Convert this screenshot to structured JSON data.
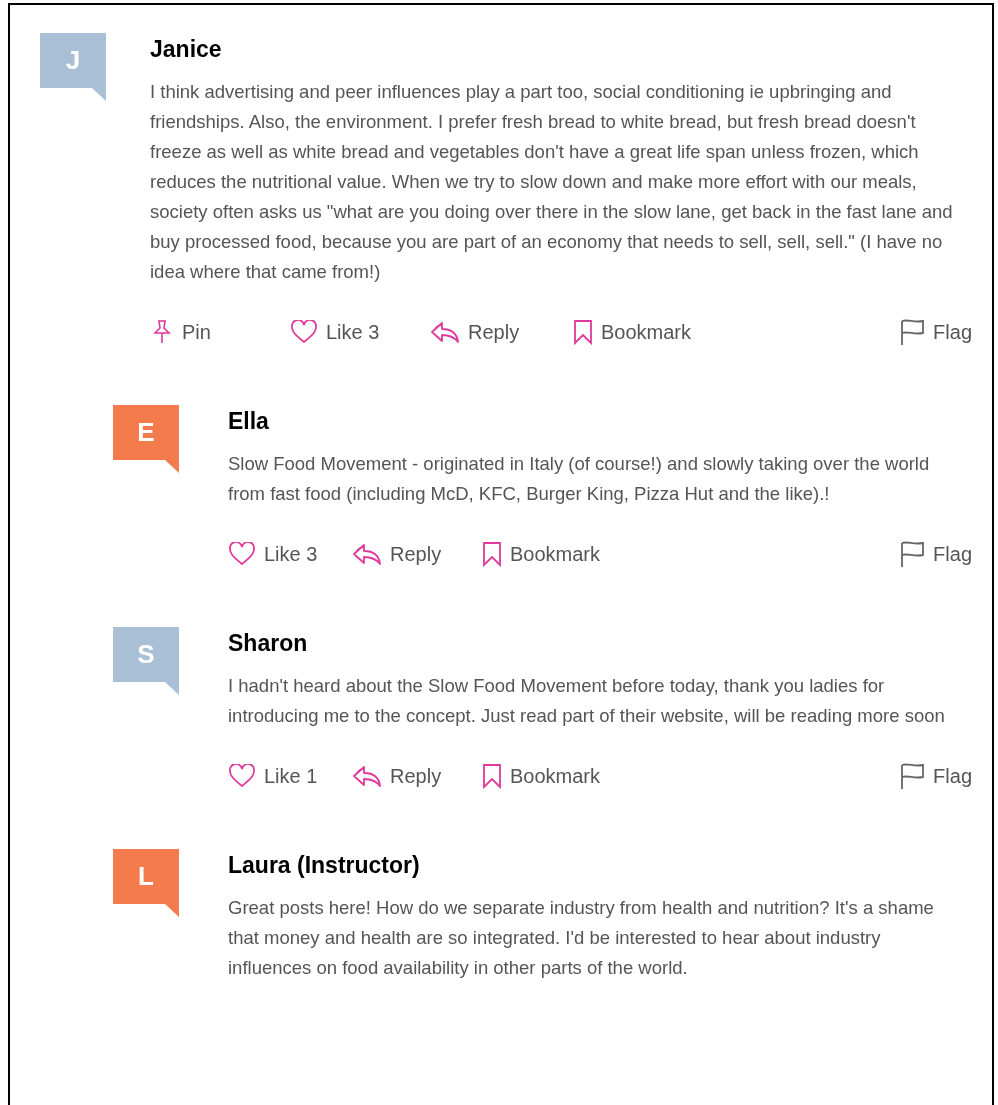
{
  "comments": [
    {
      "author": "Janice",
      "avatar": {
        "letter": "J",
        "color": "#a9bfd6"
      },
      "reply": false,
      "text": "I think advertising and peer influences play a part too, social conditioning ie upbringing and friendships. Also, the environment. I prefer fresh bread to white bread, but fresh bread doesn't freeze as well as white bread and vegetables don't have a great life span unless frozen, which reduces the nutritional value. When we try to slow down and make more effort with our meals, society often asks us \"what are you doing over there in the slow lane, get back in the fast lane and buy processed food, because you are part of an economy that needs to sell, sell, sell.\" (I have no idea where that came from!)",
      "actions": [
        {
          "kind": "pin",
          "label": "Pin"
        },
        {
          "kind": "like",
          "label": "Like",
          "count": "3"
        },
        {
          "kind": "reply",
          "label": "Reply"
        },
        {
          "kind": "bookmark",
          "label": "Bookmark"
        },
        {
          "kind": "flag",
          "label": "Flag"
        }
      ]
    },
    {
      "author": "Ella",
      "avatar": {
        "letter": "E",
        "color": "#f47c4c"
      },
      "reply": true,
      "text": "Slow Food Movement - originated in Italy (of course!) and slowly taking over the world from fast food (including McD, KFC, Burger King, Pizza Hut and the like).!",
      "actions": [
        {
          "kind": "like",
          "label": "Like",
          "count": "3"
        },
        {
          "kind": "reply",
          "label": "Reply"
        },
        {
          "kind": "bookmark",
          "label": "Bookmark"
        },
        {
          "kind": "flag",
          "label": "Flag"
        }
      ]
    },
    {
      "author": "Sharon",
      "avatar": {
        "letter": "S",
        "color": "#a9bfd6"
      },
      "reply": true,
      "text": "I hadn't heard about the Slow Food Movement before today, thank you ladies for introducing me to the concept. Just read part of their website, will be reading more soon",
      "actions": [
        {
          "kind": "like",
          "label": "Like",
          "count": "1"
        },
        {
          "kind": "reply",
          "label": "Reply"
        },
        {
          "kind": "bookmark",
          "label": "Bookmark"
        },
        {
          "kind": "flag",
          "label": "Flag"
        }
      ]
    },
    {
      "author": "Laura (Instructor)",
      "avatar": {
        "letter": "L",
        "color": "#f47c4c"
      },
      "reply": true,
      "text": "Great posts here! How do we separate industry from health and nutrition? It's a shame that money and health are so integrated. I'd be interested to hear about industry influences on food availability in other parts of the world."
    }
  ]
}
